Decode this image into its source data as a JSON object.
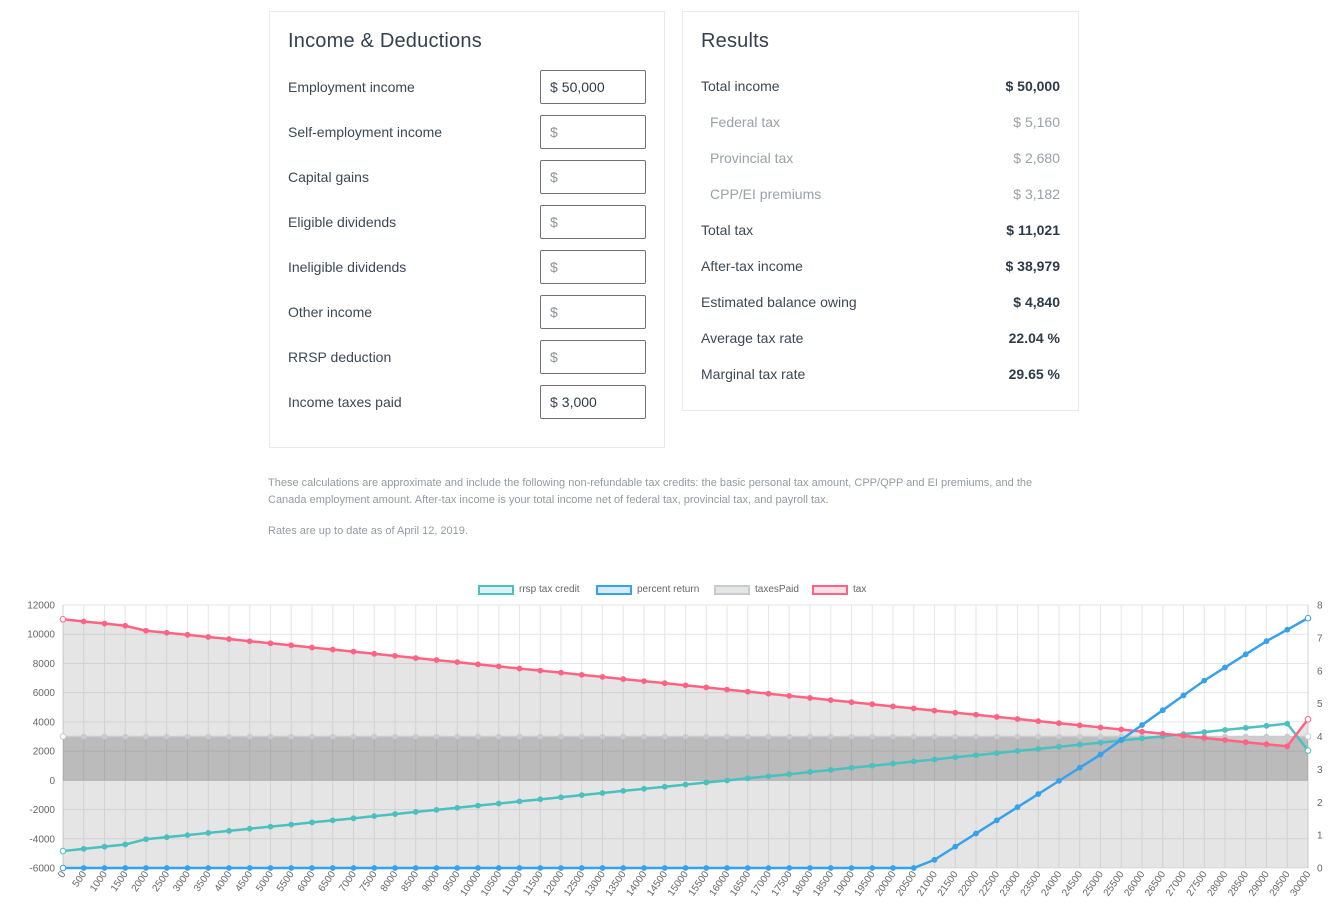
{
  "income_card": {
    "title": "Income & Deductions",
    "fields": [
      {
        "label": "Employment income",
        "prefix": "$",
        "value": "50,000"
      },
      {
        "label": "Self-employment income",
        "prefix": "$",
        "value": ""
      },
      {
        "label": "Capital gains",
        "prefix": "$",
        "value": ""
      },
      {
        "label": "Eligible dividends",
        "prefix": "$",
        "value": ""
      },
      {
        "label": "Ineligible dividends",
        "prefix": "$",
        "value": ""
      },
      {
        "label": "Other income",
        "prefix": "$",
        "value": ""
      },
      {
        "label": "RRSP deduction",
        "prefix": "$",
        "value": ""
      },
      {
        "label": "Income taxes paid",
        "prefix": "$",
        "value": "3,000"
      }
    ]
  },
  "results_card": {
    "title": "Results",
    "rows": [
      {
        "label": "Total income",
        "value": "$ 50,000",
        "sub": false
      },
      {
        "label": "Federal tax",
        "value": "$ 5,160",
        "sub": true
      },
      {
        "label": "Provincial tax",
        "value": "$ 2,680",
        "sub": true
      },
      {
        "label": "CPP/EI premiums",
        "value": "$ 3,182",
        "sub": true
      },
      {
        "label": "Total tax",
        "value": "$ 11,021",
        "sub": false
      },
      {
        "label": "After-tax income",
        "value": "$ 38,979",
        "sub": false
      },
      {
        "label": "Estimated balance owing",
        "value": "$ 4,840",
        "sub": false
      },
      {
        "label": "Average tax rate",
        "value": "22.04 %",
        "sub": false
      },
      {
        "label": "Marginal tax rate",
        "value": "29.65 %",
        "sub": false
      }
    ]
  },
  "notes": {
    "credits": "These calculations are approximate and include the following non-refundable tax credits: the basic personal tax amount, CPP/QPP and EI premiums, and the Canada employment amount. After-tax income is your total income net of federal tax, provincial tax, and payroll tax.",
    "rates_date": "Rates are up to date as of April 12, 2019."
  },
  "chart_data": {
    "type": "line",
    "legend_position": "top",
    "grid": true,
    "x": [
      0,
      500,
      1000,
      1500,
      2000,
      2500,
      3000,
      3500,
      4000,
      4500,
      5000,
      5500,
      6000,
      6500,
      7000,
      7500,
      8000,
      8500,
      9000,
      9500,
      10000,
      10500,
      11000,
      11500,
      12000,
      12500,
      13000,
      13500,
      14000,
      14500,
      15000,
      15500,
      16000,
      16500,
      17000,
      17500,
      18000,
      18500,
      19000,
      19500,
      20000,
      20500,
      21000,
      21500,
      22000,
      22500,
      23000,
      23500,
      24000,
      24500,
      25000,
      25500,
      26000,
      26500,
      27000,
      27500,
      28000,
      28500,
      29000,
      29500,
      30000
    ],
    "y_left_ticks": [
      12000,
      10000,
      8000,
      6000,
      4000,
      2000,
      0,
      -2000,
      -4000,
      -6000
    ],
    "y_left_range": [
      -6000,
      12000
    ],
    "y_right_ticks": [
      8,
      7,
      6,
      5,
      4,
      3,
      2,
      1,
      0
    ],
    "y_right_range": [
      0,
      8
    ],
    "series": [
      {
        "name": "rrsp tax credit",
        "axis": "left",
        "color": "#4bc0c0",
        "fill": "rgba(75,192,192,0.2)",
        "values": [
          -4840,
          -4690,
          -4540,
          -4390,
          -4030,
          -3890,
          -3750,
          -3600,
          -3460,
          -3310,
          -3170,
          -3030,
          -2880,
          -2740,
          -2600,
          -2450,
          -2310,
          -2160,
          -2020,
          -1880,
          -1730,
          -1590,
          -1440,
          -1300,
          -1160,
          -1010,
          -870,
          -720,
          -580,
          -440,
          -290,
          -150,
          -10,
          140,
          280,
          420,
          570,
          710,
          860,
          1000,
          1140,
          1290,
          1430,
          1580,
          1720,
          1860,
          2010,
          2150,
          2300,
          2440,
          2580,
          2730,
          2870,
          3010,
          3160,
          3300,
          3450,
          3590,
          3730,
          3880,
          2040
        ]
      },
      {
        "name": "percent return",
        "axis": "right",
        "color": "#36a2eb",
        "fill": "none",
        "values": [
          0,
          0,
          0,
          0,
          0,
          0,
          0,
          0,
          0,
          0,
          0,
          0,
          0,
          0,
          0,
          0,
          0,
          0,
          0,
          0,
          0,
          0,
          0,
          0,
          0,
          0,
          0,
          0,
          0,
          0,
          0,
          0,
          0,
          0,
          0,
          0,
          0,
          0,
          0,
          0,
          0,
          0,
          0.25,
          0.65,
          1.05,
          1.45,
          1.85,
          2.25,
          2.65,
          3.05,
          3.45,
          3.9,
          4.35,
          4.8,
          5.25,
          5.7,
          6.1,
          6.5,
          6.9,
          7.25,
          7.6
        ]
      },
      {
        "name": "taxesPaid",
        "axis": "left",
        "color": "#c9cbcf",
        "fill": "rgba(100,100,100,0.2)",
        "values": [
          3000,
          3000,
          3000,
          3000,
          3000,
          3000,
          3000,
          3000,
          3000,
          3000,
          3000,
          3000,
          3000,
          3000,
          3000,
          3000,
          3000,
          3000,
          3000,
          3000,
          3000,
          3000,
          3000,
          3000,
          3000,
          3000,
          3000,
          3000,
          3000,
          3000,
          3000,
          3000,
          3000,
          3000,
          3000,
          3000,
          3000,
          3000,
          3000,
          3000,
          3000,
          3000,
          3000,
          3000,
          3000,
          3000,
          3000,
          3000,
          3000,
          3000,
          3000,
          3000,
          3000,
          3000,
          3000,
          3000,
          3000,
          3000,
          3000,
          3000,
          3000
        ]
      },
      {
        "name": "tax",
        "axis": "left",
        "color": "#ff6384",
        "fill": "rgba(201,203,207,0.3)",
        "values": [
          11021,
          10870,
          10730,
          10580,
          10240,
          10100,
          9960,
          9810,
          9670,
          9520,
          9380,
          9240,
          9090,
          8950,
          8810,
          8660,
          8520,
          8370,
          8230,
          8090,
          7940,
          7800,
          7650,
          7510,
          7370,
          7220,
          7080,
          6930,
          6790,
          6650,
          6500,
          6360,
          6210,
          6070,
          5930,
          5780,
          5640,
          5490,
          5350,
          5210,
          5060,
          4920,
          4770,
          4630,
          4490,
          4340,
          4200,
          4050,
          3910,
          3770,
          3620,
          3480,
          3330,
          3190,
          3050,
          2900,
          2760,
          2610,
          2470,
          2330,
          4180
        ]
      }
    ]
  }
}
